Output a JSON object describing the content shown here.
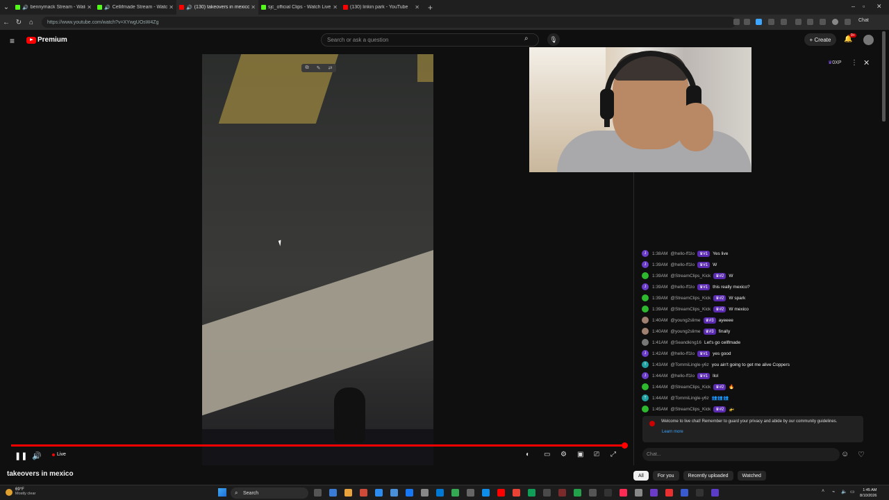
{
  "browser": {
    "tabs": [
      {
        "label": "bennymack Stream - Watch Li...",
        "favicon_color": "#53fc18",
        "audio": true,
        "active": false
      },
      {
        "label": "Cellifmade Stream - Watch Liv...",
        "favicon_color": "#53fc18",
        "audio": true,
        "active": false
      },
      {
        "label": "(130) takeovers in mexico - Yo...",
        "favicon_color": "#ff0000",
        "audio": true,
        "active": true
      },
      {
        "label": "sjc_official Clips - Watch Live...",
        "favicon_color": "#53fc18",
        "audio": false,
        "active": false
      },
      {
        "label": "(130) linkin park - YouTube",
        "favicon_color": "#ff0000",
        "audio": false,
        "active": false
      }
    ],
    "url": "https://www.youtube.com/watch?v=XYwgUOsW4Zg",
    "chat_ext": "Chat"
  },
  "header": {
    "brand": "Premium",
    "search_placeholder": "Search or ask a question",
    "create_label": "Create",
    "notif_count": "9+"
  },
  "video": {
    "title": "takeovers in mexico",
    "live_label": "Live",
    "progress": 1.0
  },
  "chat": {
    "xp": "0XP",
    "messages": [
      {
        "time": "1:38AM",
        "user": "@hello-ff1lo",
        "badge": "#1",
        "text": "Yes live",
        "color": "#6a3cc8",
        "initial": "J"
      },
      {
        "time": "1:39AM",
        "user": "@hello-ff1lo",
        "badge": "#1",
        "text": "W",
        "color": "#6a3cc8",
        "initial": "J"
      },
      {
        "time": "1:39AM",
        "user": "@StreamClips_Kick",
        "badge": "#2",
        "text": "W",
        "color": "#2eb82e",
        "initial": ""
      },
      {
        "time": "1:39AM",
        "user": "@hello-ff1lo",
        "badge": "#1",
        "text": "this really mexico?",
        "color": "#6a3cc8",
        "initial": "J"
      },
      {
        "time": "1:39AM",
        "user": "@StreamClips_Kick",
        "badge": "#2",
        "text": "W spark",
        "color": "#2eb82e",
        "initial": ""
      },
      {
        "time": "1:39AM",
        "user": "@StreamClips_Kick",
        "badge": "#2",
        "text": "W mexico",
        "color": "#2eb82e",
        "initial": ""
      },
      {
        "time": "1:40AM",
        "user": "@young2slime",
        "badge": "#3",
        "text": "ayeeee",
        "color": "#a08070",
        "initial": ""
      },
      {
        "time": "1:40AM",
        "user": "@young2slime",
        "badge": "#3",
        "text": "finally",
        "color": "#a08070",
        "initial": ""
      },
      {
        "time": "1:41AM",
        "user": "@Seandking16",
        "badge": "",
        "text": "Let's go cellfmade",
        "color": "#777777",
        "initial": ""
      },
      {
        "time": "1:42AM",
        "user": "@hello-ff1lo",
        "badge": "#1",
        "text": "yes good",
        "color": "#6a3cc8",
        "initial": "J"
      },
      {
        "time": "1:43AM",
        "user": "@TommiLingle-y6z",
        "badge": "",
        "text": "you ain't going to get me alive Coppers",
        "color": "#20a0a0",
        "initial": "T"
      },
      {
        "time": "1:44AM",
        "user": "@hello-ff1lo",
        "badge": "#1",
        "text": "llol",
        "color": "#6a3cc8",
        "initial": "J"
      },
      {
        "time": "1:44AM",
        "user": "@StreamClips_Kick",
        "badge": "#2",
        "text": "🔥",
        "color": "#2eb82e",
        "initial": ""
      },
      {
        "time": "1:44AM",
        "user": "@TommiLingle-y6z",
        "badge": "",
        "text": "👥👥👥",
        "color": "#20a0a0",
        "initial": "T"
      },
      {
        "time": "1:45AM",
        "user": "@StreamClips_Kick",
        "badge": "#2",
        "text": "🚁",
        "color": "#2eb82e",
        "initial": ""
      }
    ],
    "welcome_text": "Welcome to live chat! Remember to guard your privacy and abide by our community guidelines.",
    "learn_more": "Learn more",
    "input_placeholder": "Chat..."
  },
  "filter_chips": [
    "All",
    "For you",
    "Recently uploaded",
    "Watched"
  ],
  "taskbar": {
    "temp": "69°F",
    "weather": "Mostly clear",
    "search_label": "Search",
    "time": "1:45 AM",
    "date": "8/10/2026"
  }
}
